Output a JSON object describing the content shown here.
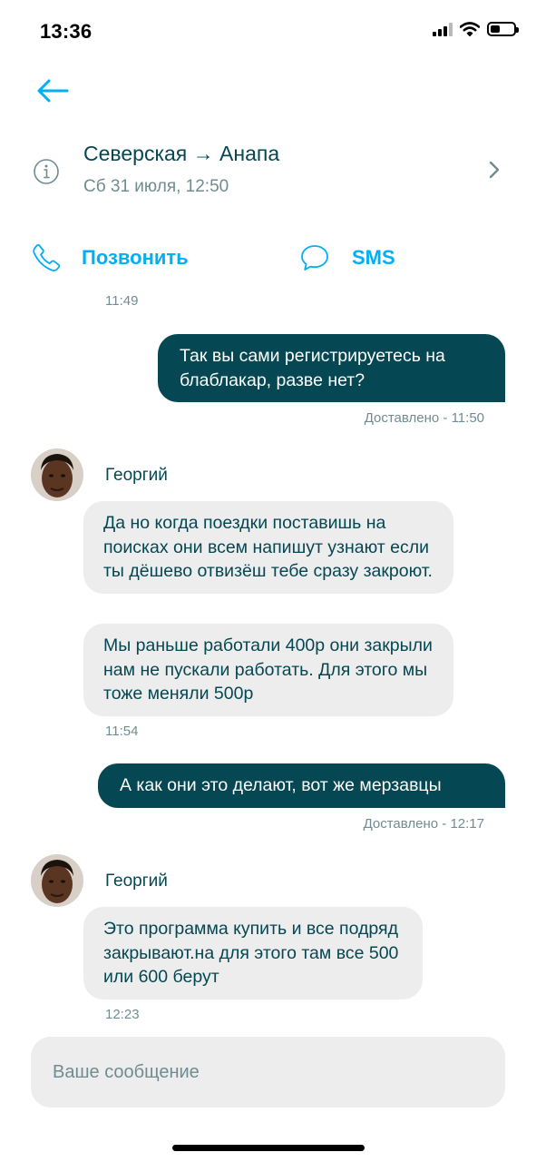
{
  "status_bar": {
    "time": "13:36",
    "signal_bars": 3,
    "battery_level": 0.4
  },
  "header": {
    "back_icon": "arrow-left-icon",
    "info_icon": "info-circle-icon",
    "route": "Северская → Анапа",
    "date": "Сб 31 июля, 12:50",
    "chevron_icon": "chevron-right-icon"
  },
  "actions": {
    "call": {
      "label": "Позвонить",
      "icon": "phone-icon"
    },
    "sms": {
      "label": "SMS",
      "icon": "chat-bubble-icon"
    }
  },
  "messages": [
    {
      "kind": "time",
      "text": "11:49"
    },
    {
      "kind": "out",
      "text": "Так вы сами регистрируетесь на блаблакар, разве нет?",
      "status": "Доставлено - 11:50"
    },
    {
      "kind": "sender",
      "name": "Георгий"
    },
    {
      "kind": "in",
      "text": "Да но когда поездки поставишь на поисках они всем напишут узнают если ты дёшево отвизёш тебе сразу закроют."
    },
    {
      "kind": "in",
      "text": "Мы раньше работали 400р они закрыли нам не пускали работать. Для этого мы тоже меняли 500р"
    },
    {
      "kind": "time",
      "text": "11:54"
    },
    {
      "kind": "out",
      "text": "А как они это делают, вот же мерзавцы",
      "status": "Доставлено - 12:17"
    },
    {
      "kind": "sender",
      "name": "Георгий"
    },
    {
      "kind": "in",
      "text": "Это программа купить и все подряд закрывают.на для этого там все 500 или 600 берут"
    },
    {
      "kind": "time",
      "text": "12:23"
    }
  ],
  "composer": {
    "placeholder": "Ваше сообщение"
  },
  "colors": {
    "primary": "#054752",
    "accent": "#00aff5",
    "muted": "#708c91",
    "bubble_in": "#ededed"
  }
}
